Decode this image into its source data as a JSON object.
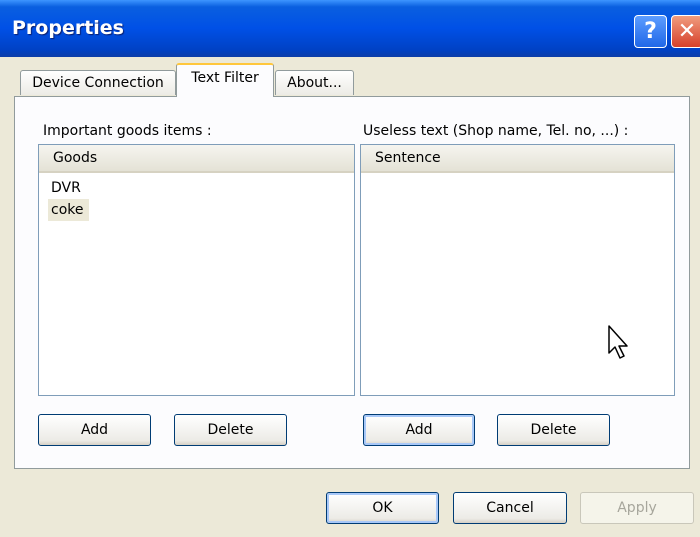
{
  "window": {
    "title": "Properties",
    "help_glyph": "?",
    "close_glyph": "✕"
  },
  "tabs": [
    {
      "label": "Device Connection",
      "active": false
    },
    {
      "label": "Text Filter",
      "active": true
    },
    {
      "label": "About...",
      "active": false
    }
  ],
  "left_group": {
    "label": "Important goods items :",
    "column_header": "Goods",
    "items": [
      "DVR",
      "coke"
    ],
    "selected_item": "coke",
    "add_label": "Add",
    "delete_label": "Delete"
  },
  "right_group": {
    "label": "Useless text (Shop name, Tel. no, ...) :",
    "column_header": "Sentence",
    "items": [],
    "add_label": "Add",
    "delete_label": "Delete"
  },
  "footer": {
    "ok_label": "OK",
    "cancel_label": "Cancel",
    "apply_label": "Apply"
  },
  "icons": [
    "help-icon",
    "close-icon",
    "mouse-pointer-icon"
  ],
  "colors": {
    "titlebar": "#0050E6",
    "dialog_bg": "#ECE9D8",
    "active_tab_accent": "#FFC73C",
    "close_button": "#D6402B"
  }
}
